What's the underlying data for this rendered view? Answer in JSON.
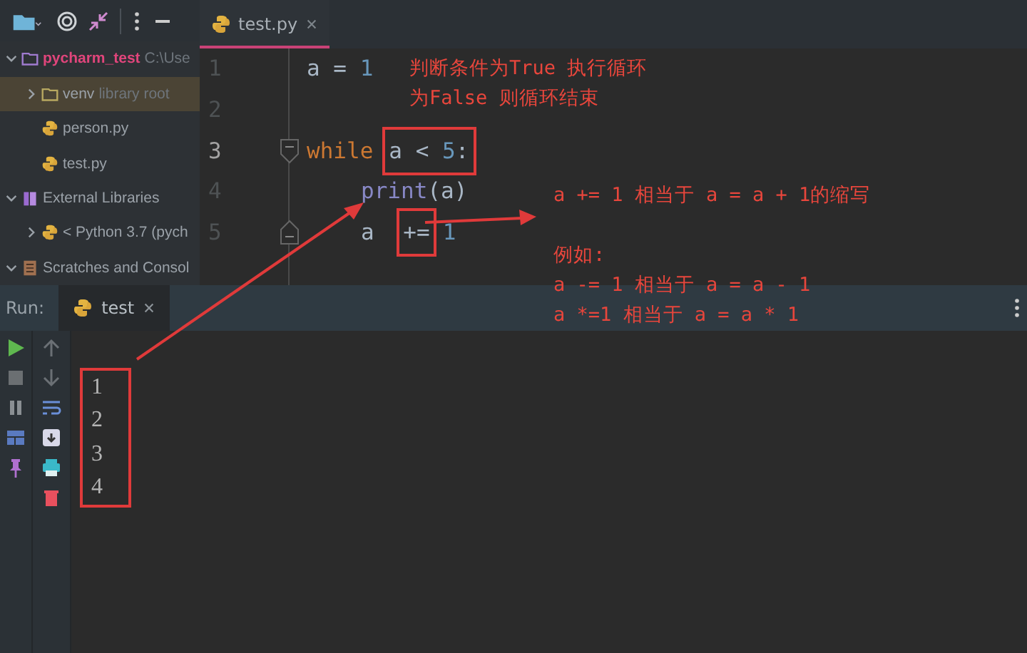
{
  "project_tree": [
    {
      "label": "pycharm_test",
      "hint": "C:\\Use",
      "kind": "project",
      "expanded": true,
      "selected": false,
      "children": [
        {
          "label": "venv",
          "hint": "library root",
          "kind": "folder",
          "expanded": false,
          "selected": true
        },
        {
          "label": "person.py",
          "kind": "python",
          "selected": false
        },
        {
          "label": "test.py",
          "kind": "python",
          "selected": false
        }
      ]
    },
    {
      "label": "External Libraries",
      "kind": "library",
      "expanded": true,
      "selected": false,
      "children": [
        {
          "label": "< Python 3.7 (pych",
          "kind": "python",
          "expanded": false,
          "selected": false
        }
      ]
    },
    {
      "label": "Scratches and Consol",
      "kind": "scratch",
      "expanded": true,
      "selected": false
    }
  ],
  "editor_tabs": [
    {
      "label": "test.py",
      "selected": true
    }
  ],
  "code_lines": [
    {
      "number": "1",
      "current": false,
      "tokens": [
        {
          "text": "a = ",
          "kind": "plain",
          "boxed": false
        },
        {
          "text": "1",
          "kind": "number",
          "boxed": false
        }
      ]
    },
    {
      "number": "2",
      "current": false
    },
    {
      "number": "3",
      "current": true,
      "fold_open": true,
      "tokens": [
        {
          "text": "while",
          "kind": "keyword",
          "boxed": false
        },
        {
          "text": "a < ",
          "kind": "plain",
          "boxed": true
        },
        {
          "text": "5",
          "kind": "number",
          "boxed": true
        },
        {
          "text": ":",
          "kind": "plain",
          "boxed": true
        }
      ]
    },
    {
      "number": "4",
      "current": false,
      "indented": true,
      "tokens": [
        {
          "text": "print",
          "kind": "builtin",
          "boxed": false
        },
        {
          "text": "(a)",
          "kind": "plain",
          "boxed": false
        }
      ]
    },
    {
      "number": "5",
      "current": false,
      "fold_close": true,
      "indented": true,
      "tokens": [
        {
          "text": "a ",
          "kind": "plain",
          "boxed": false
        },
        {
          "text": "+=",
          "kind": "plain",
          "boxed": true
        },
        {
          "text": "1",
          "kind": "number",
          "boxed": false
        }
      ]
    }
  ],
  "notes": [
    {
      "lines": [
        "判断条件为True 执行循环",
        "为False 则循环结束"
      ]
    },
    {
      "lines": [
        "a += 1 相当于 a = a + 1的缩写"
      ]
    },
    {
      "lines": [
        "例如:",
        "a -= 1 相当于 a = a - 1",
        "a *=1 相当于 a = a * 1"
      ]
    }
  ],
  "run_panel": {
    "label": "Run:",
    "tabs": [
      {
        "label": "test",
        "selected": true
      }
    ],
    "output": [
      "1",
      "2",
      "3",
      "4"
    ]
  }
}
